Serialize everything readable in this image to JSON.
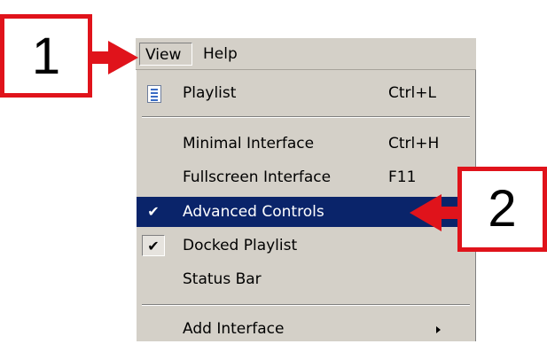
{
  "menubar": {
    "view_label": "View",
    "help_label": "Help"
  },
  "menu": {
    "items": [
      {
        "label": "Playlist",
        "shortcut": "Ctrl+L",
        "icon": "playlist-icon"
      },
      {
        "label": "Minimal Interface",
        "shortcut": "Ctrl+H"
      },
      {
        "label": "Fullscreen Interface",
        "shortcut": "F11"
      },
      {
        "label": "Advanced Controls",
        "shortcut": "",
        "checked": true,
        "selected": true
      },
      {
        "label": "Docked Playlist",
        "shortcut": "",
        "checked": true
      },
      {
        "label": "Status Bar",
        "shortcut": ""
      },
      {
        "label": "Add Interface",
        "shortcut": "",
        "submenu": true
      }
    ],
    "check_glyph": "✔",
    "selection_color": "#0a246a"
  },
  "callouts": {
    "one": "1",
    "two": "2",
    "color": "#e0131b"
  }
}
